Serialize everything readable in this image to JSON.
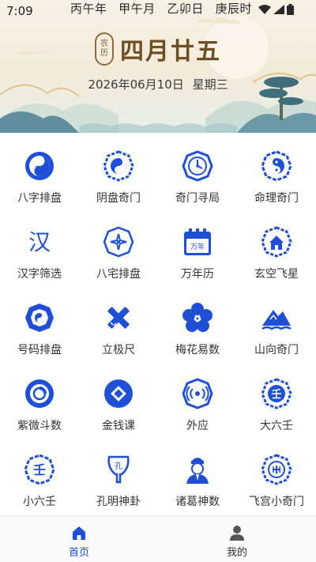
{
  "status_bar": {
    "time": "7:09",
    "ganzhi": [
      "丙午年",
      "甲午月",
      "乙卯日",
      "庚辰时"
    ]
  },
  "header": {
    "badge_top": "农",
    "badge_bottom": "历",
    "lunar_date": "四月廿五",
    "solar_date": "2026年06月10日",
    "weekday": "星期三"
  },
  "grid_items": [
    {
      "label": "八字排盘",
      "icon": "bazi-icon"
    },
    {
      "label": "阴盘奇门",
      "icon": "yinpan-icon"
    },
    {
      "label": "奇门寻局",
      "icon": "qimen-xunju-icon"
    },
    {
      "label": "命理奇门",
      "icon": "mingli-icon"
    },
    {
      "label": "汉字筛选",
      "icon": "hanzi-icon"
    },
    {
      "label": "八宅排盘",
      "icon": "bazhai-icon"
    },
    {
      "label": "万年历",
      "icon": "calendar-icon"
    },
    {
      "label": "玄空飞星",
      "icon": "xuankong-icon"
    },
    {
      "label": "号码排盘",
      "icon": "haoma-icon"
    },
    {
      "label": "立极尺",
      "icon": "ruler-icon"
    },
    {
      "label": "梅花易数",
      "icon": "plum-blossom-icon"
    },
    {
      "label": "山向奇门",
      "icon": "mountain-icon"
    },
    {
      "label": "紫微斗数",
      "icon": "ziwei-icon"
    },
    {
      "label": "金钱课",
      "icon": "coin-icon"
    },
    {
      "label": "外应",
      "icon": "waiying-icon"
    },
    {
      "label": "大六壬",
      "icon": "daliuren-icon"
    },
    {
      "label": "小六壬",
      "icon": "xiaoliuren-icon"
    },
    {
      "label": "孔明神卦",
      "icon": "kongming-fan-icon"
    },
    {
      "label": "诸葛神数",
      "icon": "zhuge-icon"
    },
    {
      "label": "飞宫小奇门",
      "icon": "feigong-icon"
    }
  ],
  "icon_text": {
    "hanzi": "汉",
    "calendar": "万年",
    "ren": "壬",
    "kong": "孔"
  },
  "bottom_nav": {
    "home_label": "首页",
    "me_label": "我的"
  },
  "colors": {
    "accent": "#1e4fd6",
    "lunar_text": "#6e4f22"
  }
}
